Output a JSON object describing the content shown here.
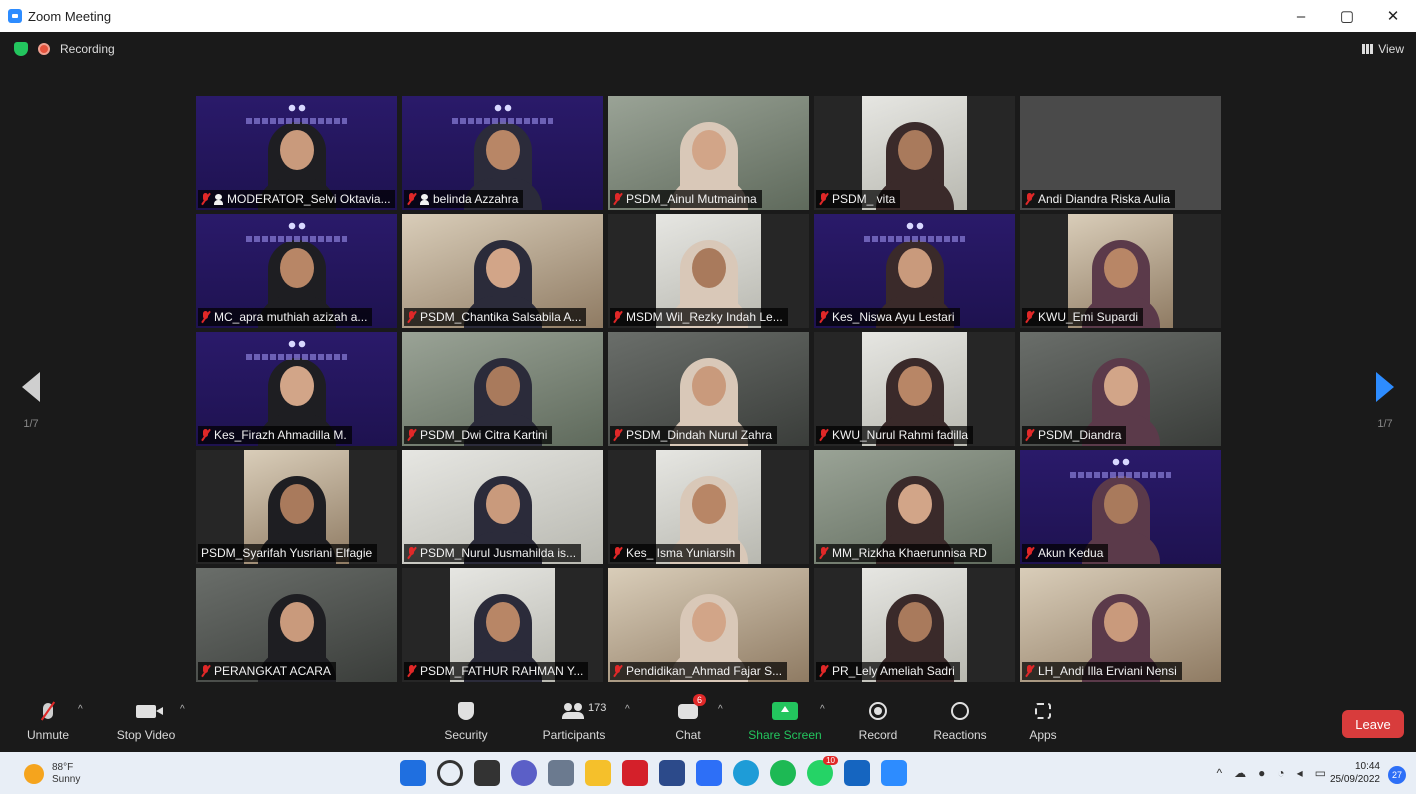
{
  "window": {
    "title": "Zoom Meeting",
    "controls": [
      "–",
      "▢",
      "✕"
    ]
  },
  "meeting": {
    "recording_label": "Recording",
    "view_label": "View",
    "page_indicator": "1/7"
  },
  "participants": [
    {
      "name": "MODERATOR_Selvi Oktavia...",
      "bg": "banner",
      "muted": true,
      "host": true,
      "active": true
    },
    {
      "name": "belinda Azzahra",
      "bg": "banner",
      "muted": true,
      "host": true
    },
    {
      "name": "PSDM_Ainul Mutmainna",
      "bg": "wall",
      "muted": true
    },
    {
      "name": "PSDM_ vita",
      "bg": "light",
      "muted": true
    },
    {
      "name": "Andi Diandra Riska Aulia",
      "bg": "grey",
      "muted": true
    },
    {
      "name": "MC_apra muthiah azizah a...",
      "bg": "banner",
      "muted": true
    },
    {
      "name": "PSDM_Chantika Salsabila A...",
      "bg": "room",
      "muted": true
    },
    {
      "name": "MSDM Wil_Rezky Indah Le...",
      "bg": "light",
      "muted": true
    },
    {
      "name": "Kes_Niswa Ayu Lestari",
      "bg": "banner",
      "muted": true
    },
    {
      "name": "KWU_Emi Supardi",
      "bg": "room",
      "muted": true
    },
    {
      "name": "Kes_Firazh Ahmadilla M.",
      "bg": "banner",
      "muted": true
    },
    {
      "name": "PSDM_Dwi Citra Kartini",
      "bg": "wall",
      "muted": true
    },
    {
      "name": "PSDM_Dindah Nurul Zahra",
      "bg": "dark",
      "muted": true
    },
    {
      "name": "KWU_Nurul Rahmi fadilla",
      "bg": "light",
      "muted": true
    },
    {
      "name": "PSDM_Diandra",
      "bg": "dark",
      "muted": true
    },
    {
      "name": "PSDM_Syarifah Yusriani Elfagie",
      "bg": "room",
      "muted": false
    },
    {
      "name": "PSDM_Nurul Jusmahilda is...",
      "bg": "light",
      "muted": true
    },
    {
      "name": "Kes_ Isma Yuniarsih",
      "bg": "light",
      "muted": true
    },
    {
      "name": "MM_Rizkha Khaerunnisa RD",
      "bg": "wall",
      "muted": true
    },
    {
      "name": "Akun Kedua",
      "bg": "banner",
      "muted": true
    },
    {
      "name": "PERANGKAT ACARA",
      "bg": "dark",
      "muted": true
    },
    {
      "name": "PSDM_FATHUR RAHMAN Y...",
      "bg": "light",
      "muted": true
    },
    {
      "name": "Pendidikan_Ahmad Fajar S...",
      "bg": "room",
      "muted": true
    },
    {
      "name": "PR_Lely Ameliah Sadri",
      "bg": "light",
      "muted": true
    },
    {
      "name": "LH_Andi Illa Erviani Nensi",
      "bg": "room",
      "muted": true
    }
  ],
  "toolbar": {
    "unmute": "Unmute",
    "stop_video": "Stop Video",
    "security": "Security",
    "participants": "Participants",
    "participants_count": "173",
    "chat": "Chat",
    "chat_badge": "6",
    "share_screen": "Share Screen",
    "record": "Record",
    "reactions": "Reactions",
    "apps": "Apps",
    "leave": "Leave"
  },
  "taskbar": {
    "weather_temp": "88°F",
    "weather_desc": "Sunny",
    "time": "10:44",
    "date": "25/09/2022",
    "notification_count": "27",
    "whatsapp_badge": "10"
  },
  "colors": {
    "accent": "#2d8cff",
    "share_green": "#23c55e",
    "leave_red": "#d83c3c",
    "active_speaker": "#d6e34a"
  }
}
